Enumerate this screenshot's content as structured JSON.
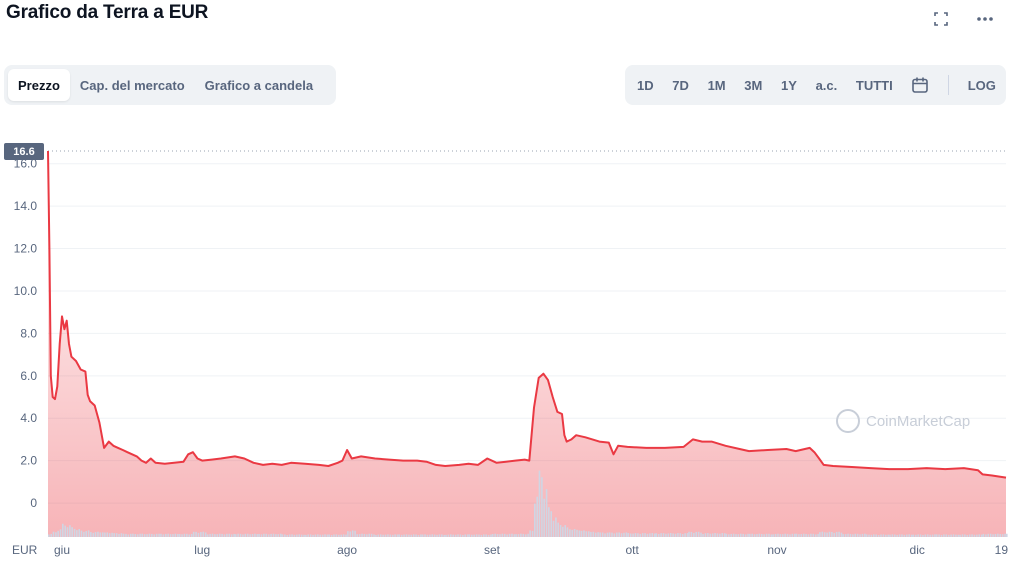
{
  "header": {
    "title": "Grafico da Terra a EUR",
    "fullscreen_icon": "fullscreen-icon",
    "more_icon": "more-horizontal-icon"
  },
  "tabs_left": [
    "Prezzo",
    "Cap. del mercato",
    "Grafico a candela"
  ],
  "active_tab": "Prezzo",
  "range_tabs": [
    "1D",
    "7D",
    "1M",
    "3M",
    "1Y",
    "a.c.",
    "TUTTI"
  ],
  "calendar_icon": "calendar-icon",
  "log_label": "LOG",
  "watermark": "CoinMarketCap",
  "colors": {
    "line": "#ea3943",
    "fill": "#ea3943",
    "volume": "#cfd6e4",
    "tag": "#58667e"
  },
  "chart_data": {
    "type": "area",
    "currency_label": "EUR",
    "current_value_tag": "16.6",
    "ylim": [
      -1.6,
      16.6
    ],
    "y_ticks": [
      0,
      2.0,
      4.0,
      6.0,
      8.0,
      10.0,
      12.0,
      14.0,
      16.0
    ],
    "y_tick_labels": [
      "0",
      "2.0",
      "4.0",
      "6.0",
      "8.0",
      "10.0",
      "12.0",
      "14.0",
      "16.0"
    ],
    "x_range": [
      0,
      205
    ],
    "x_ticks": [
      {
        "label": "giu",
        "x": 3
      },
      {
        "label": "lug",
        "x": 33
      },
      {
        "label": "ago",
        "x": 64
      },
      {
        "label": "set",
        "x": 95
      },
      {
        "label": "ott",
        "x": 125
      },
      {
        "label": "nov",
        "x": 156
      },
      {
        "label": "dic",
        "x": 186
      },
      {
        "label": "19",
        "x": 204
      }
    ],
    "price": [
      [
        0,
        16.6
      ],
      [
        0.3,
        12.0
      ],
      [
        0.6,
        6.0
      ],
      [
        1.0,
        5.0
      ],
      [
        1.5,
        4.9
      ],
      [
        2.0,
        5.5
      ],
      [
        2.5,
        7.5
      ],
      [
        3.0,
        8.8
      ],
      [
        3.5,
        8.2
      ],
      [
        4.0,
        8.6
      ],
      [
        4.5,
        7.5
      ],
      [
        5.0,
        6.9
      ],
      [
        6.0,
        6.7
      ],
      [
        7.0,
        6.3
      ],
      [
        8.0,
        6.2
      ],
      [
        8.5,
        5.1
      ],
      [
        9.0,
        4.8
      ],
      [
        10.0,
        4.6
      ],
      [
        11.0,
        3.8
      ],
      [
        12.0,
        2.6
      ],
      [
        13.0,
        2.9
      ],
      [
        14.0,
        2.7
      ],
      [
        15.0,
        2.6
      ],
      [
        16.0,
        2.5
      ],
      [
        17.0,
        2.4
      ],
      [
        18.0,
        2.3
      ],
      [
        19.0,
        2.2
      ],
      [
        20.0,
        2.0
      ],
      [
        21.0,
        1.9
      ],
      [
        22.0,
        2.1
      ],
      [
        23.0,
        1.9
      ],
      [
        25.0,
        1.85
      ],
      [
        27.0,
        1.9
      ],
      [
        29.0,
        1.95
      ],
      [
        30.0,
        2.3
      ],
      [
        31.0,
        2.4
      ],
      [
        32.0,
        2.1
      ],
      [
        33.0,
        2.0
      ],
      [
        35.0,
        2.05
      ],
      [
        37.0,
        2.1
      ],
      [
        40.0,
        2.2
      ],
      [
        42.0,
        2.1
      ],
      [
        44.0,
        1.9
      ],
      [
        46.0,
        1.8
      ],
      [
        48.0,
        1.85
      ],
      [
        50.0,
        1.8
      ],
      [
        52.0,
        1.9
      ],
      [
        55.0,
        1.85
      ],
      [
        58.0,
        1.8
      ],
      [
        60.0,
        1.75
      ],
      [
        62.0,
        1.9
      ],
      [
        63.0,
        2.0
      ],
      [
        64.0,
        2.5
      ],
      [
        65.0,
        2.1
      ],
      [
        67.0,
        2.2
      ],
      [
        70.0,
        2.1
      ],
      [
        73.0,
        2.05
      ],
      [
        76.0,
        2.0
      ],
      [
        79.0,
        2.0
      ],
      [
        81.0,
        1.95
      ],
      [
        83.0,
        1.8
      ],
      [
        85.0,
        1.75
      ],
      [
        88.0,
        1.8
      ],
      [
        90.0,
        1.85
      ],
      [
        92.0,
        1.8
      ],
      [
        94.0,
        2.1
      ],
      [
        96.0,
        1.9
      ],
      [
        98.0,
        1.95
      ],
      [
        100.0,
        2.0
      ],
      [
        102.0,
        2.05
      ],
      [
        103.0,
        2.0
      ],
      [
        104.0,
        4.5
      ],
      [
        105.0,
        5.9
      ],
      [
        106.0,
        6.1
      ],
      [
        107.0,
        5.8
      ],
      [
        108.0,
        5.0
      ],
      [
        109.0,
        4.3
      ],
      [
        110.0,
        4.2
      ],
      [
        110.5,
        3.2
      ],
      [
        111.0,
        2.9
      ],
      [
        112.0,
        3.0
      ],
      [
        113.0,
        3.2
      ],
      [
        115.0,
        3.1
      ],
      [
        118.0,
        2.9
      ],
      [
        120.0,
        2.85
      ],
      [
        121.0,
        2.3
      ],
      [
        122.0,
        2.7
      ],
      [
        124.0,
        2.65
      ],
      [
        128.0,
        2.6
      ],
      [
        132.0,
        2.6
      ],
      [
        136.0,
        2.65
      ],
      [
        138.0,
        3.0
      ],
      [
        140.0,
        2.9
      ],
      [
        142.0,
        2.9
      ],
      [
        145.0,
        2.7
      ],
      [
        148.0,
        2.55
      ],
      [
        150.0,
        2.45
      ],
      [
        154.0,
        2.5
      ],
      [
        158.0,
        2.55
      ],
      [
        160.0,
        2.45
      ],
      [
        163.0,
        2.6
      ],
      [
        164.0,
        2.4
      ],
      [
        165.0,
        2.1
      ],
      [
        166.0,
        1.8
      ],
      [
        168.0,
        1.75
      ],
      [
        172.0,
        1.7
      ],
      [
        176.0,
        1.65
      ],
      [
        180.0,
        1.6
      ],
      [
        184.0,
        1.6
      ],
      [
        188.0,
        1.65
      ],
      [
        192.0,
        1.6
      ],
      [
        196.0,
        1.65
      ],
      [
        199.0,
        1.55
      ],
      [
        200.0,
        1.35
      ],
      [
        202.0,
        1.3
      ],
      [
        205.0,
        1.2
      ]
    ],
    "volume_relative": [
      [
        0,
        0.05
      ],
      [
        1,
        0.08
      ],
      [
        2,
        0.12
      ],
      [
        3,
        0.2
      ],
      [
        4,
        0.18
      ],
      [
        5,
        0.15
      ],
      [
        6,
        0.12
      ],
      [
        7,
        0.1
      ],
      [
        8,
        0.1
      ],
      [
        9,
        0.08
      ],
      [
        10,
        0.08
      ],
      [
        12,
        0.07
      ],
      [
        14,
        0.06
      ],
      [
        16,
        0.05
      ],
      [
        18,
        0.05
      ],
      [
        20,
        0.05
      ],
      [
        24,
        0.05
      ],
      [
        28,
        0.05
      ],
      [
        31,
        0.08
      ],
      [
        34,
        0.05
      ],
      [
        40,
        0.05
      ],
      [
        45,
        0.05
      ],
      [
        50,
        0.04
      ],
      [
        55,
        0.04
      ],
      [
        60,
        0.04
      ],
      [
        64,
        0.1
      ],
      [
        66,
        0.05
      ],
      [
        70,
        0.04
      ],
      [
        75,
        0.04
      ],
      [
        80,
        0.04
      ],
      [
        85,
        0.04
      ],
      [
        90,
        0.04
      ],
      [
        95,
        0.05
      ],
      [
        100,
        0.05
      ],
      [
        103,
        0.1
      ],
      [
        104,
        0.65
      ],
      [
        105,
        1.0
      ],
      [
        106,
        0.75
      ],
      [
        107,
        0.45
      ],
      [
        108,
        0.3
      ],
      [
        109,
        0.22
      ],
      [
        110,
        0.18
      ],
      [
        111,
        0.15
      ],
      [
        112,
        0.12
      ],
      [
        114,
        0.1
      ],
      [
        116,
        0.08
      ],
      [
        118,
        0.07
      ],
      [
        120,
        0.07
      ],
      [
        124,
        0.06
      ],
      [
        130,
        0.06
      ],
      [
        137,
        0.08
      ],
      [
        140,
        0.06
      ],
      [
        145,
        0.05
      ],
      [
        150,
        0.05
      ],
      [
        155,
        0.05
      ],
      [
        160,
        0.05
      ],
      [
        165,
        0.08
      ],
      [
        170,
        0.05
      ],
      [
        175,
        0.04
      ],
      [
        180,
        0.04
      ],
      [
        185,
        0.04
      ],
      [
        190,
        0.04
      ],
      [
        195,
        0.04
      ],
      [
        200,
        0.05
      ],
      [
        205,
        0.05
      ]
    ]
  }
}
